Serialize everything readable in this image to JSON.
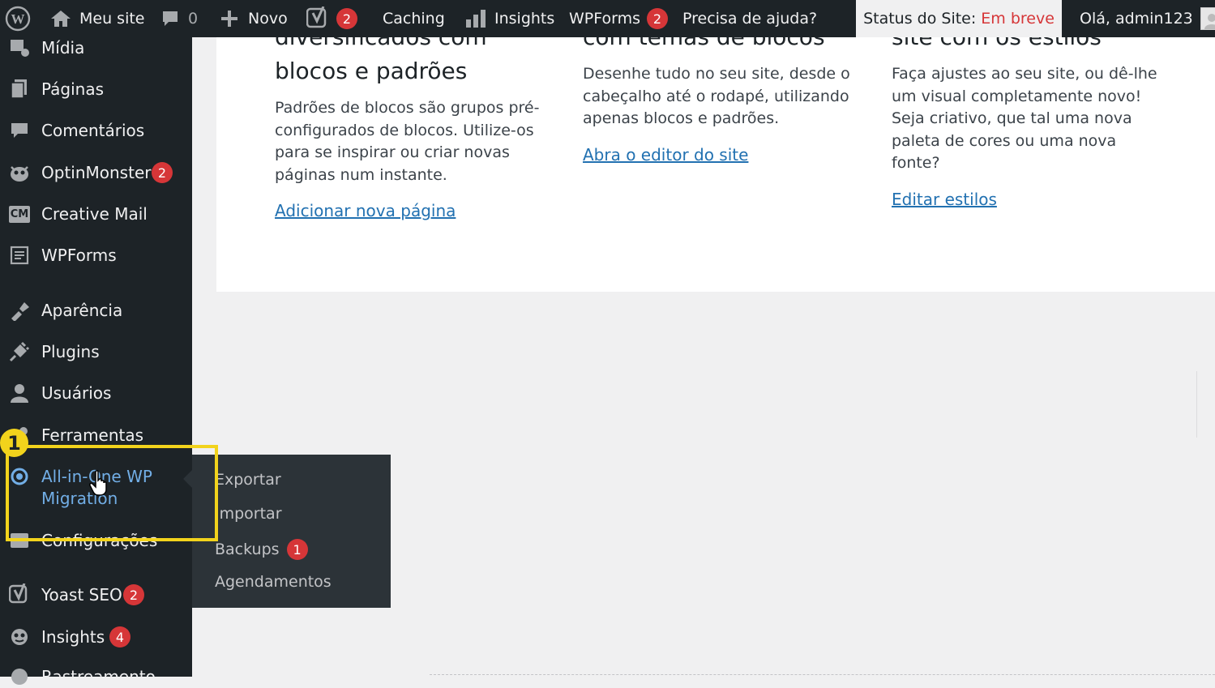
{
  "adminbar": {
    "site_name": "Meu site",
    "comments_count": "0",
    "new_label": "Novo",
    "yoast_badge": "2",
    "caching_label": "Caching",
    "insights_label": "Insights",
    "wpforms_label": "WPForms",
    "wpforms_badge": "2",
    "help_label": "Precisa de ajuda?",
    "status_label": "Status do Site:",
    "status_value": "Em breve",
    "greeting": "Olá, admin123"
  },
  "sidebar": {
    "items": [
      {
        "label": "Mídia",
        "icon": "media-icon"
      },
      {
        "label": "Páginas",
        "icon": "pages-icon"
      },
      {
        "label": "Comentários",
        "icon": "comments-icon"
      },
      {
        "label": "OptinMonster",
        "icon": "optinmonster-icon",
        "badge": "2"
      },
      {
        "label": "Creative Mail",
        "icon": "creative-mail-icon",
        "icon_text": "CM"
      },
      {
        "label": "WPForms",
        "icon": "wpforms-icon"
      },
      {
        "label": "Aparência",
        "icon": "appearance-icon"
      },
      {
        "label": "Plugins",
        "icon": "plugins-icon"
      },
      {
        "label": "Usuários",
        "icon": "users-icon"
      },
      {
        "label": "Ferramentas",
        "icon": "tools-icon"
      },
      {
        "label": "All-in-One WP Migration",
        "icon": "migration-icon"
      },
      {
        "label": "Configurações",
        "icon": "settings-icon"
      },
      {
        "label": "Yoast SEO",
        "icon": "yoast-icon",
        "badge": "2"
      },
      {
        "label": "Insights",
        "icon": "insights-icon",
        "badge": "4"
      },
      {
        "label": "Rastreamento",
        "icon": "tracking-icon"
      }
    ]
  },
  "submenu": {
    "items": [
      {
        "label": "Exportar"
      },
      {
        "label": "Importar"
      },
      {
        "label": "Backups",
        "badge": "1"
      },
      {
        "label": "Agendamentos"
      }
    ]
  },
  "main": {
    "columns": [
      {
        "heading_top": "diversificados com",
        "heading": "blocos e padrões",
        "text": "Padrões de blocos são grupos pré-configurados de blocos. Utilize-os para se inspirar ou criar novas páginas num instante.",
        "link": "Adicionar nova página"
      },
      {
        "heading_top": "com temas de blocos",
        "text": "Desenhe tudo no seu site, desde o cabeçalho até o rodapé, utilizando apenas blocos e padrões.",
        "link": "Abra o editor do site"
      },
      {
        "heading_top": "site com os estilos",
        "text": "Faça ajustes ao seu site, ou dê-lhe um visual completamente novo! Seja criativo, que tal uma nova paleta de cores ou uma nova fonte?",
        "link": "Editar estilos"
      }
    ]
  },
  "annotation": {
    "step": "1"
  },
  "colors": {
    "admin_bg": "#1d2327",
    "accent_link": "#2271b1",
    "active_menu": "#72aee6",
    "badge": "#d63638",
    "highlight": "#f2d31c"
  }
}
